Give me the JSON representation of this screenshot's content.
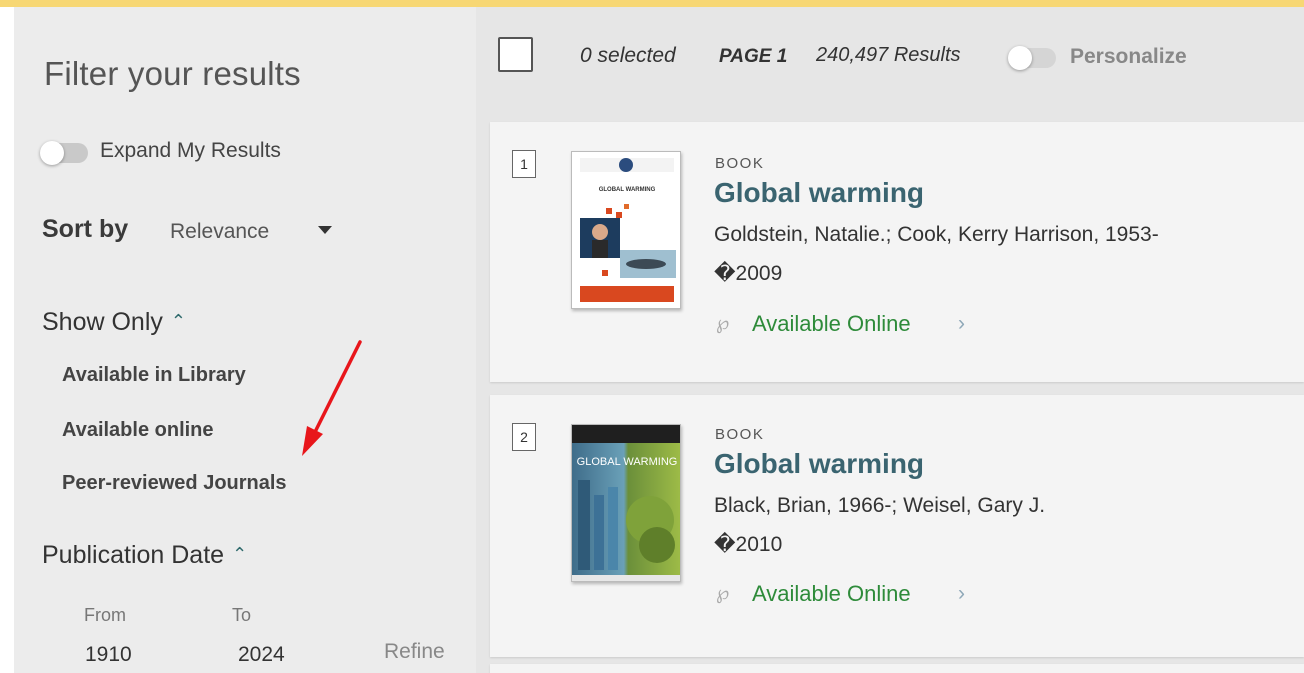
{
  "sidebar": {
    "title": "Filter your results",
    "expand_label": "Expand My Results",
    "sort_label": "Sort by",
    "sort_value": "Relevance",
    "show_only": {
      "heading": "Show Only",
      "items": [
        "Available in Library",
        "Available online",
        "Peer-reviewed Journals"
      ]
    },
    "publication_date": {
      "heading": "Publication Date",
      "from_label": "From",
      "to_label": "To",
      "from_value": "1910",
      "to_value": "2024",
      "refine_label": "Refine"
    }
  },
  "toolbar": {
    "selected": "0 selected",
    "page": "PAGE 1",
    "results": "240,497 Results",
    "personalize": "Personalize"
  },
  "results": [
    {
      "number": "1",
      "type": "BOOK",
      "title": "Global warming",
      "authors": "Goldstein, Natalie.; Cook, Kerry Harrison, 1953-",
      "year": "�2009",
      "availability": "Available Online",
      "cover_text": "GLOBAL WARMING"
    },
    {
      "number": "2",
      "type": "BOOK",
      "title": "Global warming",
      "authors": "Black, Brian, 1966-; Weisel, Gary J.",
      "year": "�2010",
      "availability": "Available Online",
      "cover_text": "GLOBAL WARMING"
    }
  ],
  "colors": {
    "accent_bar": "#f7d774",
    "title_link": "#3a6470",
    "available": "#2e8b3a",
    "annotation_arrow": "#e8161b"
  }
}
